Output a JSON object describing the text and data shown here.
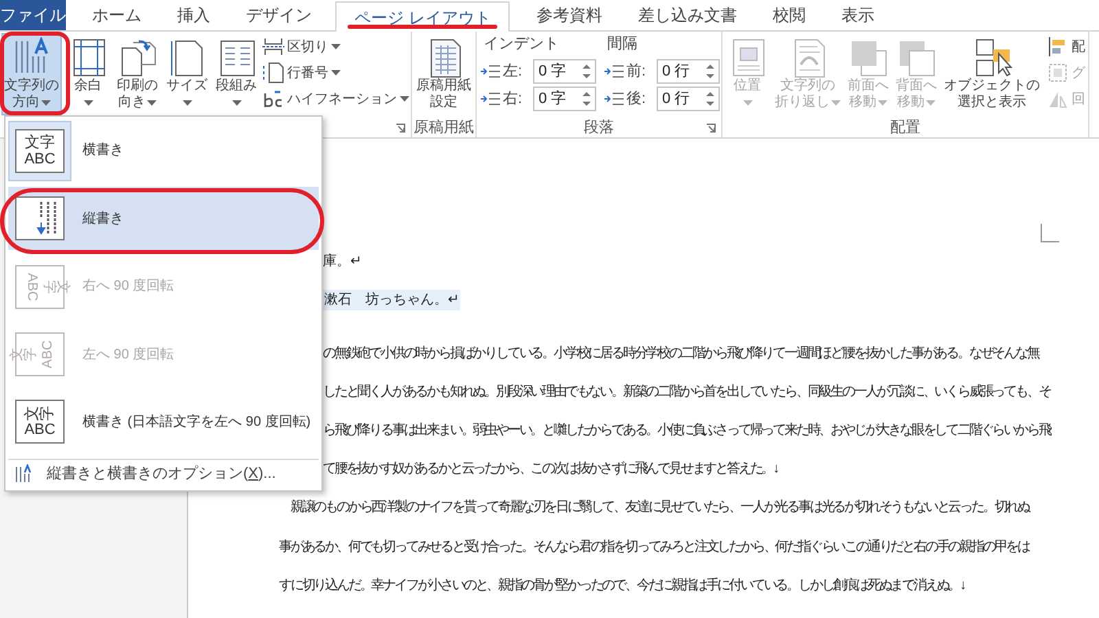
{
  "tabs": [
    {
      "label": "ファイル",
      "kind": "file",
      "selected": false
    },
    {
      "label": "ホーム",
      "kind": "tab",
      "selected": false
    },
    {
      "label": "挿入",
      "kind": "tab",
      "selected": false
    },
    {
      "label": "デザイン",
      "kind": "tab",
      "selected": false
    },
    {
      "label": "ページ レイアウト",
      "kind": "tab",
      "selected": true
    },
    {
      "label": "参考資料",
      "kind": "tab",
      "selected": false
    },
    {
      "label": "差し込み文書",
      "kind": "tab",
      "selected": false
    },
    {
      "label": "校閲",
      "kind": "tab",
      "selected": false
    },
    {
      "label": "表示",
      "kind": "tab",
      "selected": false
    }
  ],
  "ribbon": {
    "page_setup": {
      "large_buttons": [
        {
          "kind": "inline-caret",
          "lines": [
            "文字列の",
            "方向"
          ],
          "selected": true
        },
        {
          "kind": "caret-below",
          "lines": [
            "余白"
          ],
          "selected": false
        },
        {
          "kind": "inline-caret",
          "lines": [
            "印刷の",
            "向き"
          ],
          "selected": false
        },
        {
          "kind": "caret-below",
          "lines": [
            "サイズ"
          ],
          "selected": false
        },
        {
          "kind": "caret-below",
          "lines": [
            "段組み"
          ],
          "selected": false
        }
      ],
      "small_buttons": [
        {
          "label": "区切り"
        },
        {
          "label": "行番号"
        },
        {
          "label": "ハイフネーション"
        }
      ]
    },
    "manuscript": {
      "button": [
        "原稿用紙",
        "設定"
      ],
      "label": "原稿用紙"
    },
    "paragraph": {
      "label": "段落",
      "indent": {
        "title": "インデント",
        "fields": [
          {
            "label": "左:",
            "value": "0 字"
          },
          {
            "label": "右:",
            "value": "0 字"
          }
        ]
      },
      "spacing": {
        "title": "間隔",
        "fields": [
          {
            "label": "前:",
            "value": "0 行"
          },
          {
            "label": "後:",
            "value": "0 行"
          }
        ]
      }
    },
    "arrange": {
      "label": "配置",
      "large_buttons": [
        {
          "kind": "caret-below",
          "lines": [
            "位置"
          ],
          "disabled": true
        },
        {
          "kind": "inline-caret",
          "lines": [
            "文字列の",
            "折り返し"
          ],
          "disabled": true
        },
        {
          "kind": "inline-caret",
          "lines": [
            "前面へ",
            "移動"
          ],
          "disabled": true
        },
        {
          "kind": "inline-caret",
          "lines": [
            "背面へ",
            "移動"
          ],
          "disabled": true
        },
        {
          "kind": "plain",
          "lines": [
            "オブジェクトの",
            "選択と表示"
          ],
          "disabled": false
        }
      ],
      "small_buttons": [
        {
          "label": "配",
          "disabled": false
        },
        {
          "label": "グ",
          "disabled": true
        },
        {
          "label": "回",
          "disabled": true
        }
      ]
    }
  },
  "menu": {
    "items": [
      {
        "kind": "horizontal",
        "icon_lines": [
          "文字",
          "ABC"
        ],
        "label": "横書き",
        "selected": false,
        "current": true,
        "disabled": false
      },
      {
        "kind": "vertical",
        "label": "縦書き",
        "selected": true,
        "current": false,
        "disabled": false
      },
      {
        "kind": "rotate-right",
        "icon_lines": [
          "文字",
          "ABC"
        ],
        "label": "右へ 90 度回転",
        "selected": false,
        "current": false,
        "disabled": true
      },
      {
        "kind": "rotate-left",
        "icon_lines": [
          "文字",
          "ABC"
        ],
        "label": "左へ 90 度回転",
        "selected": false,
        "current": false,
        "disabled": true
      },
      {
        "kind": "horizontal-rotated",
        "icon_lines": [
          "文字",
          "ABC"
        ],
        "label": "横書き (日本語文字を左へ 90 度回転)",
        "selected": false,
        "current": false,
        "disabled": false
      }
    ],
    "footer": {
      "label_before": "縦書きと横書きのオプション(",
      "access_key": "X",
      "label_after": ")..."
    }
  },
  "document": {
    "header_lines": [
      {
        "text": "庫。↵",
        "highlighted": false
      },
      {
        "text": "漱石　坊っちゃん。↵",
        "highlighted": true
      }
    ],
    "body_lines": [
      {
        "kind": "clipped",
        "text": "の無鉄砲で小供の時から損ばかりしている。小学校に居る時分学校の二階から飛び降りて一週間ほど腰を抜かした事がある。なぜそんな無"
      },
      {
        "kind": "clipped",
        "text": "したと聞く人があるかも知れぬ。別段深い理由でもない。新築の二階から首を出していたら、同級生の一人が冗談に、いくら威張っても、そ"
      },
      {
        "kind": "clipped",
        "text": "ら飛び降りる事は出来まい。弱虫やーい。と囃したからである。小使に負ぶさって帰って来た時、おやじが大きな眼をして二階ぐらいから飛"
      },
      {
        "kind": "clipped",
        "text": "て腰を抜かす奴があるかと云ったから、この次は抜かさずに飛んで見せますと答えた。↓"
      },
      {
        "kind": "full",
        "text": "　親譲のものから西洋製のナイフを貰って奇麗な刃を日に翳して、友達に見せていたら、一人が光る事は光るが切れそうもないと云った。切れぬ"
      },
      {
        "kind": "full",
        "text": "事があるか、何でも切ってみせると受け合った。そんなら君の指を切ってみろと注文したから、何だ指ぐらいこの通りだと右の手の親指の甲をは"
      },
      {
        "kind": "full",
        "text": "すに切り込んだ。幸ナイフが小さいのと、親指の骨が堅かったので、今だに親指は手に付いている。しかし創痕は死ぬまで消えぬ。↓"
      }
    ]
  }
}
